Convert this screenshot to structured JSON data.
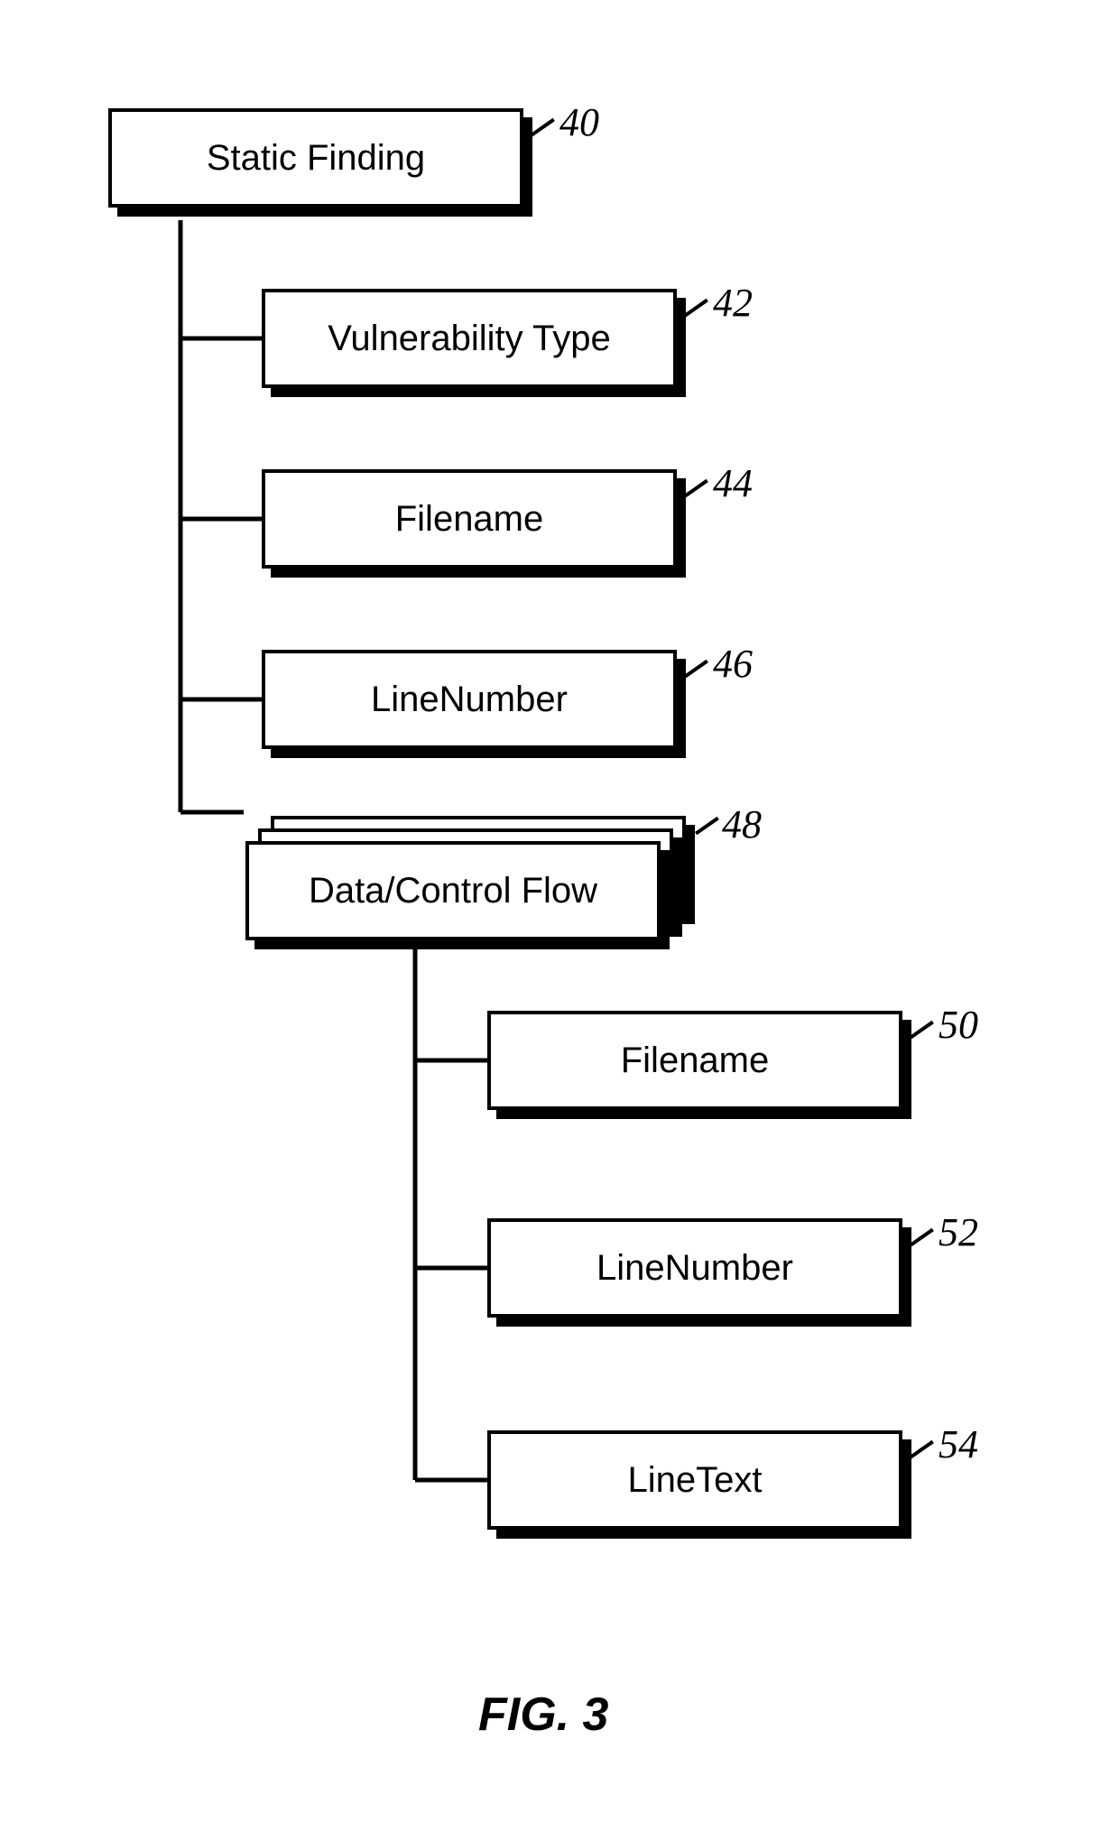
{
  "figure_caption": "FIG. 3",
  "nodes": {
    "root": {
      "label": "Static Finding",
      "ref": "40"
    },
    "n1": {
      "label": "Vulnerability Type",
      "ref": "42"
    },
    "n2": {
      "label": "Filename",
      "ref": "44"
    },
    "n3": {
      "label": "LineNumber",
      "ref": "46"
    },
    "n4": {
      "label": "Data/Control  Flow",
      "ref": "48"
    },
    "n5": {
      "label": "Filename",
      "ref": "50"
    },
    "n6": {
      "label": "LineNumber",
      "ref": "52"
    },
    "n7": {
      "label": "LineText",
      "ref": "54"
    }
  }
}
